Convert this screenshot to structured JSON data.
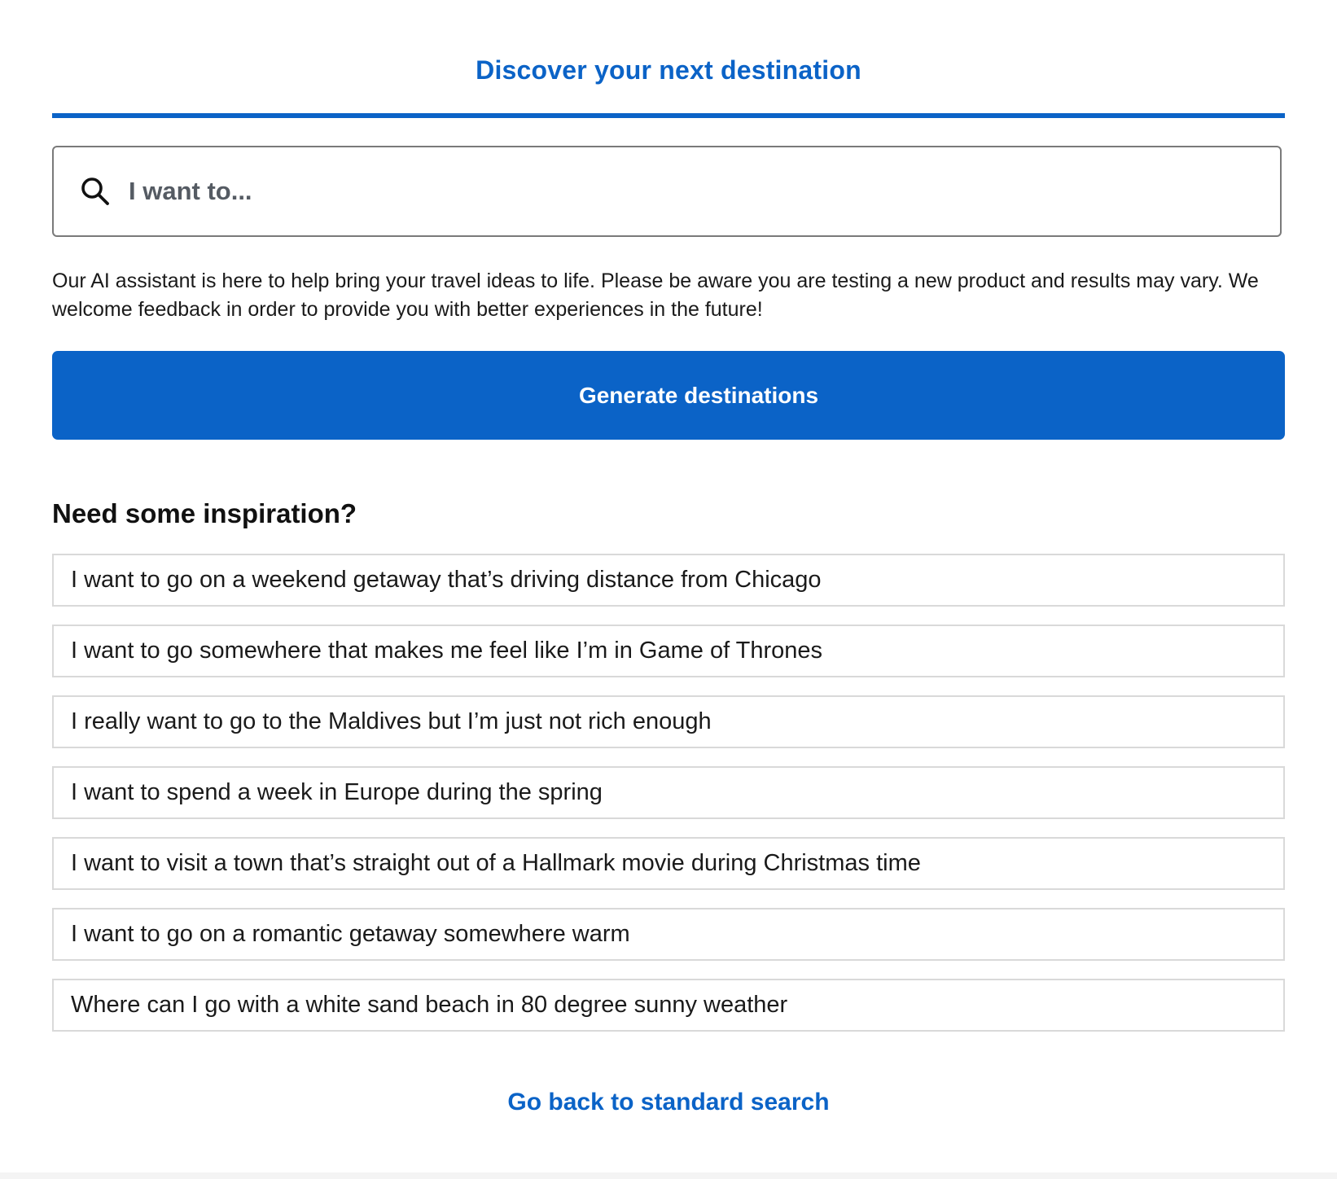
{
  "header": {
    "title": "Discover your next destination"
  },
  "search": {
    "placeholder": "I want to...",
    "value": "",
    "icon": "search-icon"
  },
  "disclaimer": {
    "text": "Our AI assistant is here to help bring your travel ideas to life. Please be aware you are testing a new product and results may vary. We welcome feedback in order to provide you with better experiences in the future!"
  },
  "generate": {
    "label": "Generate destinations"
  },
  "inspiration": {
    "heading": "Need some inspiration?",
    "items": [
      "I want to go on a weekend getaway that’s driving distance from Chicago",
      "I want to go somewhere that makes me feel like I’m in Game of Thrones",
      "I really want to go to the Maldives but I’m just not rich enough",
      "I want to spend a week in Europe during the spring",
      "I want to visit a town that’s straight out of a Hallmark movie during Christmas time",
      "I want to go on a romantic getaway somewhere warm",
      "Where can I go with a white sand beach in 80 degree sunny weather"
    ]
  },
  "footer": {
    "back_link": "Go back to standard search"
  },
  "colors": {
    "accent": "#0b63c7",
    "border": "#d9d9d9",
    "text": "#1a1a1a"
  }
}
